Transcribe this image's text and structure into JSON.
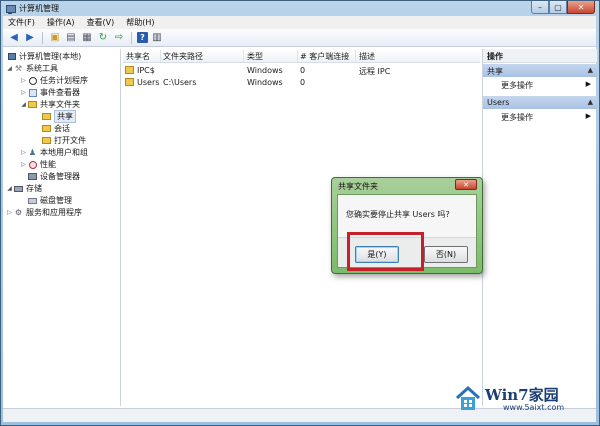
{
  "window": {
    "title": "计算机管理"
  },
  "menu": [
    "文件(F)",
    "操作(A)",
    "查看(V)",
    "帮助(H)"
  ],
  "tree": [
    {
      "label": "计算机管理(本地)",
      "icon": "computer-icon",
      "level": 0,
      "toggle": ""
    },
    {
      "label": "系统工具",
      "icon": "tools-icon",
      "level": 1,
      "toggle": "◢"
    },
    {
      "label": "任务计划程序",
      "icon": "clock-icon",
      "level": 2,
      "toggle": "▷"
    },
    {
      "label": "事件查看器",
      "icon": "event-viewer-icon",
      "level": 2,
      "toggle": "▷"
    },
    {
      "label": "共享文件夹",
      "icon": "folder-icon",
      "level": 2,
      "toggle": "◢"
    },
    {
      "label": "共享",
      "icon": "share-folder-icon",
      "level": 3,
      "toggle": ""
    },
    {
      "label": "会话",
      "icon": "session-icon",
      "level": 3,
      "toggle": ""
    },
    {
      "label": "打开文件",
      "icon": "open-files-icon",
      "level": 3,
      "toggle": ""
    },
    {
      "label": "本地用户和组",
      "icon": "users-icon",
      "level": 2,
      "toggle": "▷"
    },
    {
      "label": "性能",
      "icon": "performance-icon",
      "level": 2,
      "toggle": "▷"
    },
    {
      "label": "设备管理器",
      "icon": "device-icon",
      "level": 2,
      "toggle": ""
    },
    {
      "label": "存储",
      "icon": "storage-icon",
      "level": 1,
      "toggle": "◢"
    },
    {
      "label": "磁盘管理",
      "icon": "disk-icon",
      "level": 2,
      "toggle": ""
    },
    {
      "label": "服务和应用程序",
      "icon": "services-icon",
      "level": 1,
      "toggle": "▷"
    }
  ],
  "list": {
    "columns": [
      "共享名",
      "文件夹路径",
      "类型",
      "# 客户端连接",
      "描述"
    ],
    "rows": [
      [
        "IPC$",
        "",
        "Windows",
        "0",
        "远程 IPC"
      ],
      [
        "Users",
        "C:\\Users",
        "Windows",
        "0",
        ""
      ]
    ]
  },
  "actions": {
    "title": "操作",
    "sections": [
      {
        "header": "共享",
        "item": "更多操作"
      },
      {
        "header": "Users",
        "item": "更多操作"
      }
    ]
  },
  "dialog": {
    "title": "共享文件夹",
    "message": "您确实要停止共享 Users 吗?",
    "yes_label": "是(Y)",
    "no_label": "否(N)"
  },
  "watermark": {
    "title": "Win7家园",
    "url": "www.5aixt.com"
  },
  "colors": {
    "highlight": "#c8202a",
    "dialog_frame": "#7dbb6c",
    "accent": "#1b3f75"
  }
}
